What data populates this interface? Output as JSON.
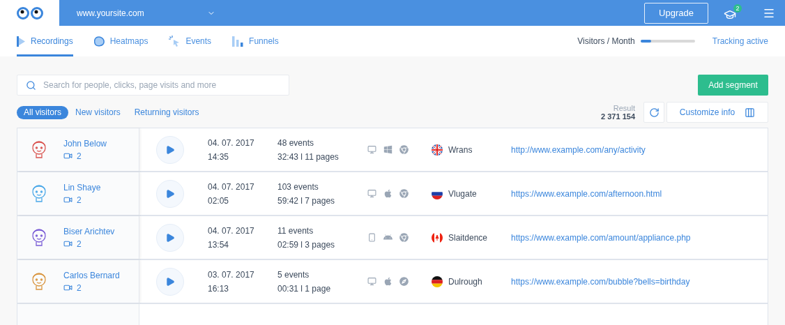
{
  "header": {
    "site": "www.yoursite.com",
    "upgrade": "Upgrade",
    "notifications": "2"
  },
  "tabs": [
    {
      "label": "Recordings",
      "kind": "recordings",
      "selected": true
    },
    {
      "label": "Heatmaps",
      "kind": "heatmaps",
      "selected": false
    },
    {
      "label": "Events",
      "kind": "events",
      "selected": false
    },
    {
      "label": "Funnels",
      "kind": "funnels",
      "selected": false
    }
  ],
  "usage": {
    "label": "Visitors / Month",
    "level": 0.2
  },
  "tracking": "Tracking active",
  "search": {
    "placeholder": "Search for people, clicks, page visits and more"
  },
  "add_segment": "Add segment",
  "filters": [
    {
      "label": "All visitors",
      "selected": true
    },
    {
      "label": "New visitors",
      "selected": false
    },
    {
      "label": "Returning visitors",
      "selected": false
    }
  ],
  "result": {
    "label": "Result",
    "value": "2 371 154"
  },
  "customize": "Customize info",
  "rows": [
    {
      "name": "John Below",
      "color": "#d9534f",
      "recordings": "2",
      "date": "04. 07. 2017",
      "time": "14:35",
      "events": "48 events",
      "duration": "32:43 l 11 pages",
      "platform_icons": [
        {
          "kind": "desktop"
        },
        {
          "kind": "windows"
        },
        {
          "kind": "chrome"
        }
      ],
      "flag": {
        "kind": "uk"
      },
      "country": "Wrans",
      "url": "http://www.example.com/any/activity"
    },
    {
      "name": "Lin Shaye",
      "color": "#4aa8e8",
      "recordings": "2",
      "date": "04. 07. 2017",
      "time": "02:05",
      "events": "103 events",
      "duration": "59:42 l 7 pages",
      "platform_icons": [
        {
          "kind": "desktop"
        },
        {
          "kind": "apple"
        },
        {
          "kind": "chrome"
        }
      ],
      "flag": {
        "kind": "ru"
      },
      "country": "Vlugate",
      "url": "https://www.example.com/afternoon.html"
    },
    {
      "name": "Biser Arichtev",
      "color": "#7a5cd6",
      "recordings": "2",
      "date": "04. 07. 2017",
      "time": "13:54",
      "events": "11 events",
      "duration": "02:59 l 3 pages",
      "platform_icons": [
        {
          "kind": "mobile"
        },
        {
          "kind": "android"
        },
        {
          "kind": "chrome"
        }
      ],
      "flag": {
        "kind": "ca"
      },
      "country": "Slaitdence",
      "url": "https://www.example.com/amount/appliance.php"
    },
    {
      "name": "Carlos Bernard",
      "color": "#d9953f",
      "recordings": "2",
      "date": "03. 07. 2017",
      "time": "16:13",
      "events": "5 events",
      "duration": "00:31 l 1 page",
      "platform_icons": [
        {
          "kind": "desktop"
        },
        {
          "kind": "apple"
        },
        {
          "kind": "safari"
        }
      ],
      "flag": {
        "kind": "de"
      },
      "country": "Dulrough",
      "url": "https://www.example.com/bubble?bells=birthday"
    }
  ]
}
